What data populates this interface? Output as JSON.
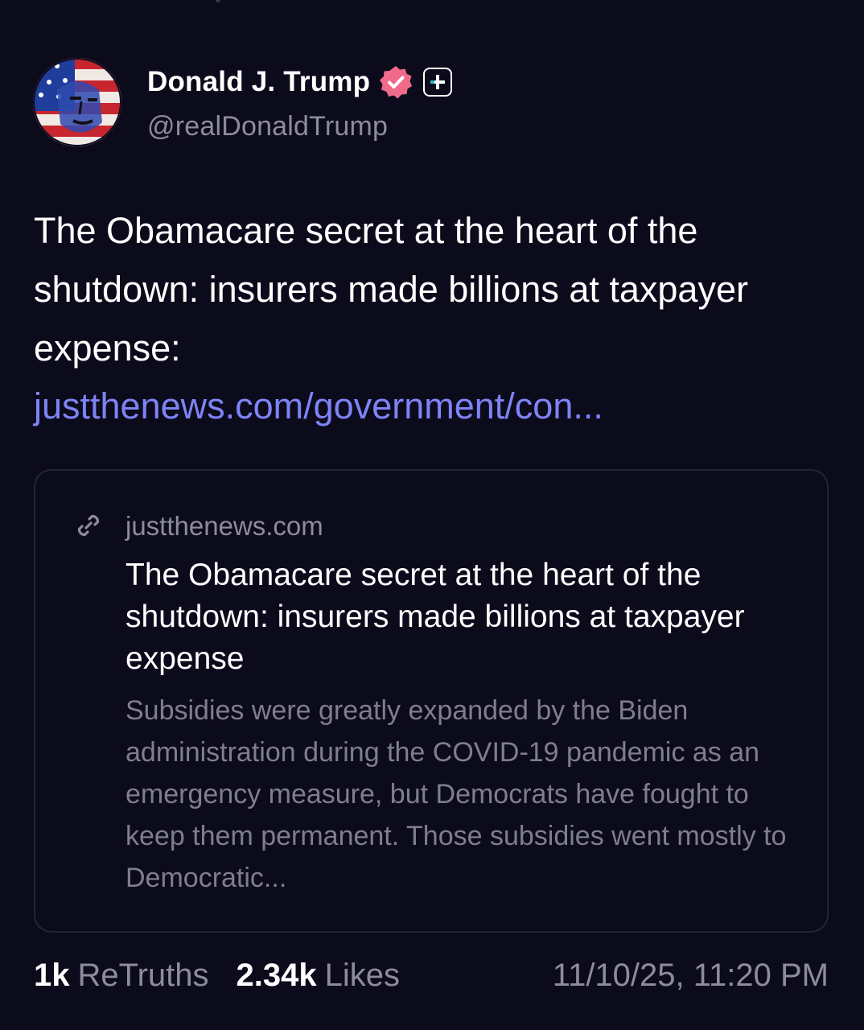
{
  "post": {
    "author": {
      "display_name": "Donald J. Trump",
      "handle": "@realDonaldTrump",
      "verified_icon": "verified-badge-icon",
      "plus_icon": "plus-badge-icon",
      "verified_color": "#f06b8a"
    },
    "text": "The Obamacare secret at the heart of the shutdown: insurers made billions at taxpayer expense:",
    "link_text": "justthenews.com/government/con...",
    "link_color": "#7e83f5"
  },
  "link_card": {
    "icon": "link-icon",
    "domain": "justthenews.com",
    "title": "The Obamacare secret at the heart of the shutdown: insurers made billions at taxpayer expense",
    "description": "Subsidies were greatly expanded by the Biden administration during the COVID-19 pandemic as an emergency measure, but Democrats have fought to keep them permanent. Those subsidies went mostly to Democratic..."
  },
  "stats": {
    "retruths_count": "1k",
    "retruths_label": "ReTruths",
    "likes_count": "2.34k",
    "likes_label": "Likes",
    "timestamp": "11/10/25, 11:20 PM"
  },
  "colors": {
    "background": "#0c0b1c",
    "muted_text": "#8d8c9e"
  }
}
